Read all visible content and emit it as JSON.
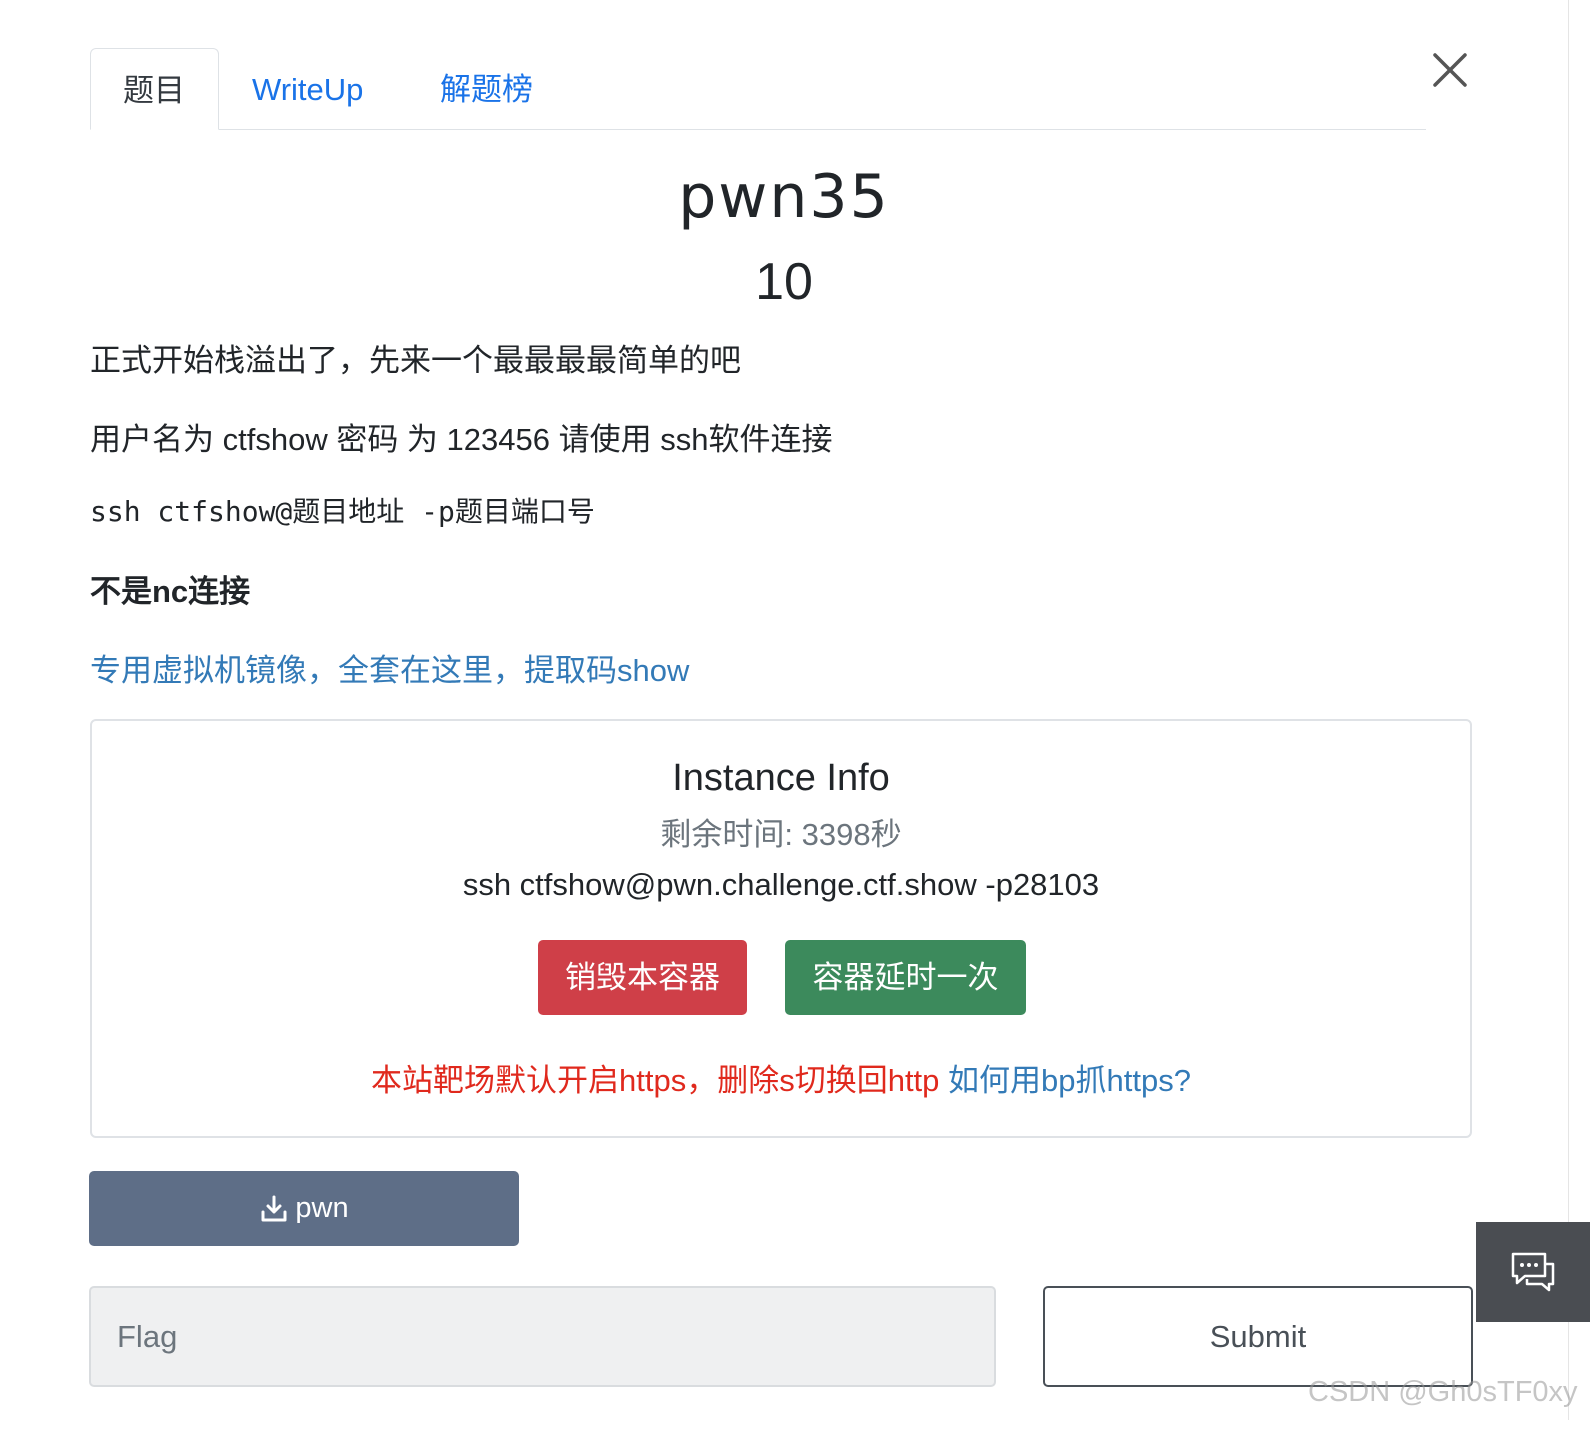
{
  "tabs": [
    {
      "label": "题目",
      "active": true
    },
    {
      "label": "WriteUp",
      "active": false
    },
    {
      "label": "解题榜",
      "active": false
    }
  ],
  "challenge": {
    "name": "pwn35",
    "points": "10",
    "description": [
      "正式开始栈溢出了，先来一个最最最最简单的吧",
      "用户名为 ctfshow 密码 为 123456 请使用 ssh软件连接",
      "ssh ctfshow@题目地址 -p题目端口号",
      "不是nc连接"
    ],
    "mirror_link": "专用虚拟机镜像，全套在这里，提取码show"
  },
  "instance": {
    "title": "Instance Info",
    "remaining": "剩余时间: 3398秒",
    "ssh_command": "ssh ctfshow@pwn.challenge.ctf.show -p28103",
    "destroy_label": "销毁本容器",
    "extend_label": "容器延时一次",
    "note_red": "本站靶场默认开启https，删除s切换回http",
    "note_link": "如何用bp抓https?"
  },
  "download": {
    "label": "pwn",
    "icon": "download-icon"
  },
  "flag_form": {
    "placeholder": "Flag",
    "submit_label": "Submit"
  },
  "chat_widget": {
    "icon": "chat-bubbles-icon"
  },
  "watermark": "CSDN @Gh0sTF0xy",
  "colors": {
    "tab_link": "#1a73e8",
    "link": "#337ab7",
    "destroy": "#cf3f48",
    "extend": "#3c8a5c",
    "download": "#5e6e87",
    "note_red": "#e0291d"
  }
}
